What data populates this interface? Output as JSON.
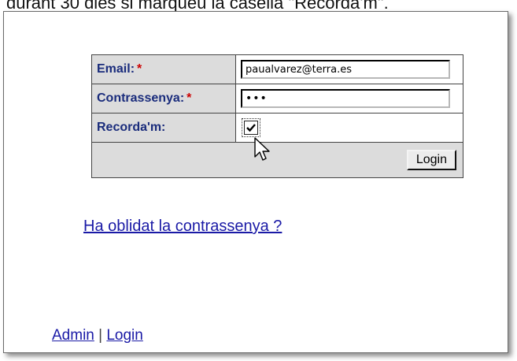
{
  "caption": "durant 30 dies si marqueu la casella \"Recorda'm\".",
  "form": {
    "email_label": "Email:",
    "email_required_mark": "*",
    "email_value": "paualvarez@terra.es",
    "password_label": "Contrassenya:",
    "password_required_mark": "*",
    "password_value": "•••",
    "remember_label": "Recorda'm:",
    "remember_checked": true,
    "login_button": "Login"
  },
  "forgot_link": "Ha oblidat la contrassenya ?",
  "footer": {
    "admin_link": "Admin",
    "separator": "|",
    "login_link": "Login"
  },
  "icons": {
    "checkbox": "checkmark-icon",
    "pointer": "mouse-cursor-icon"
  }
}
